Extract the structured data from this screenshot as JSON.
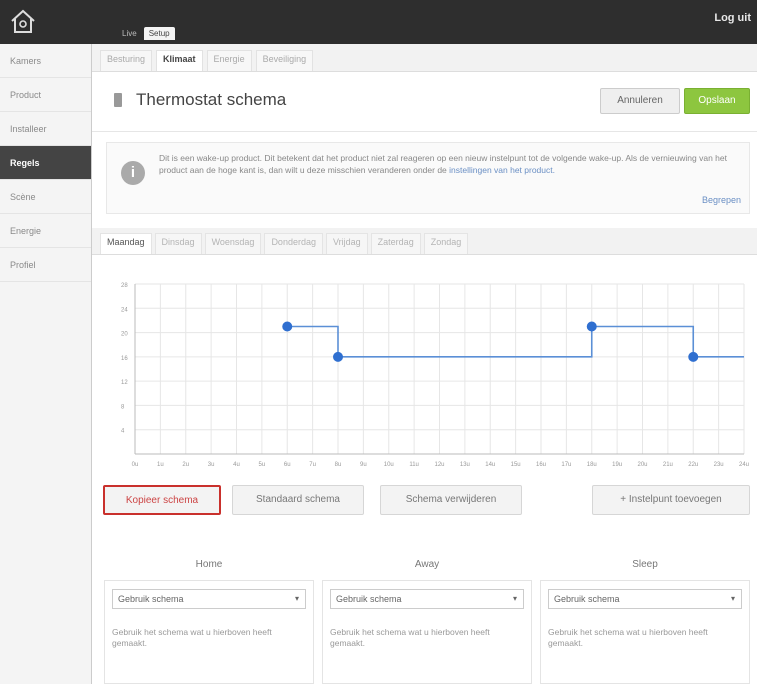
{
  "header": {
    "logo": "home-icon",
    "mode_tabs": [
      "Live",
      "Setup"
    ],
    "logout_label": "Log uit"
  },
  "sidebar": {
    "items": [
      {
        "label": "Kamers"
      },
      {
        "label": "Product"
      },
      {
        "label": "Installeer"
      },
      {
        "label": "Regels",
        "active": true
      },
      {
        "label": "Scène"
      },
      {
        "label": "Energie"
      },
      {
        "label": "Profiel"
      }
    ]
  },
  "subtabs": [
    "Besturing",
    "Klimaat",
    "Energie",
    "Beveiliging"
  ],
  "page": {
    "title": "Thermostat schema",
    "cancel_label": "Annuleren",
    "save_label": "Opslaan"
  },
  "info": {
    "text_main": "Dit is een wake-up product. Dit betekent dat het product niet zal reageren op een nieuw instelpunt tot de volgende wake-up. Als de vernieuwing van het product aan de hoge kant is, dan wilt u deze misschien veranderen onder de ",
    "text_link": "instellingen van het product.",
    "more_label": "Begrepen"
  },
  "days": [
    "Maandag",
    "Dinsdag",
    "Woensdag",
    "Donderdag",
    "Vrijdag",
    "Zaterdag",
    "Zondag"
  ],
  "schedule": {
    "setpoints": [
      {
        "hour": 6,
        "temp": 21
      },
      {
        "hour": 8,
        "temp": 16
      },
      {
        "hour": 18,
        "temp": 21
      },
      {
        "hour": 22,
        "temp": 16
      }
    ],
    "y_ticks": [
      28,
      24,
      20,
      16,
      12,
      8,
      4
    ],
    "x_ticks": [
      "0u",
      "1u",
      "2u",
      "3u",
      "4u",
      "5u",
      "6u",
      "7u",
      "8u",
      "9u",
      "10u",
      "11u",
      "12u",
      "13u",
      "14u",
      "15u",
      "16u",
      "17u",
      "18u",
      "19u",
      "20u",
      "21u",
      "22u",
      "23u",
      "24u"
    ],
    "line_color": "#5b8fd6",
    "point_color": "#2f6fd0"
  },
  "actions": {
    "copy_label": "Kopieer schema",
    "default_label": "Standaard schema",
    "clear_label": "Schema verwijderen",
    "add_label": "Instelpunt toevoegen"
  },
  "modes": [
    {
      "title": "Home",
      "select": "Gebruik schema",
      "desc": "Gebruik het schema wat u hierboven heeft gemaakt."
    },
    {
      "title": "Away",
      "select": "Gebruik schema",
      "desc": "Gebruik het schema wat u hierboven heeft gemaakt."
    },
    {
      "title": "Sleep",
      "select": "Gebruik schema",
      "desc": "Gebruik het schema wat u hierboven heeft gemaakt."
    }
  ]
}
